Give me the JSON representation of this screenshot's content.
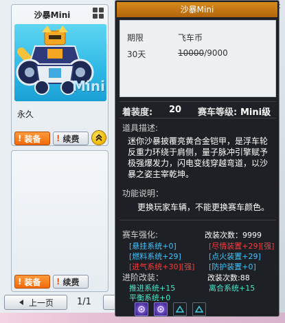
{
  "item": {
    "name": "沙暴Mini",
    "duration": "永久",
    "art_text": "Mini",
    "equip_label": "装备",
    "renew_label": "续费",
    "bang": "!"
  },
  "card2": {
    "equip_label": "装备",
    "renew_label": "续费",
    "bang": "!"
  },
  "pager": {
    "prev_label": "上一页",
    "page": "1/1"
  },
  "tooltip": {
    "title": "沙暴Mini",
    "price_header_term": "期限",
    "price_header_currency": "飞车币",
    "price_term": "30天",
    "price_original": "10000",
    "price_current": "/9000",
    "assembly_label": "着装度:",
    "assembly_value": "20",
    "grade_label": "赛车等级:",
    "grade_value": "Mini级",
    "desc_title": "道具描述:",
    "desc_text": "迷你沙暴披覆亮黄合金铠甲，是浮车轮反重力环绕于肩侧，量子脉冲引擎赋予极强爆发力，闪电变线穿越弯道，以沙暴之姿主宰乾坤。",
    "func_title": "功能说明：",
    "func_text": "更换玩家车辆，不能更换赛车颜色。",
    "tune_title": "赛车强化:",
    "tune_count_label": "改装次数：9999",
    "tune_items": [
      {
        "text": "[悬挂系统+0]",
        "color": "#3fc4ff"
      },
      {
        "text": "[尽情装置+29][强]",
        "color": "#ff3a3a"
      },
      {
        "text": "[燃料系统+29]",
        "color": "#3fc4ff"
      },
      {
        "text": "[点火装置+29]",
        "color": "#3fc4ff"
      },
      {
        "text": "[进气系统+30][强]",
        "color": "#ff3a3a"
      },
      {
        "text": "[防护装置+0]",
        "color": "#3fc4ff"
      }
    ],
    "adv_title": "进阶改装：",
    "adv_count_label": "改装次数:88",
    "adv_items": [
      {
        "text": "推进系统+15",
        "color": "#48e8c8"
      },
      {
        "text": "离合系统+15",
        "color": "#48e8c8"
      },
      {
        "text": "平衡系统+0",
        "color": "#48e8c8"
      }
    ]
  },
  "icons": {
    "close": "close-icon",
    "grid": "grid-icon",
    "chevron_up": "double-chevron-up-icon"
  },
  "colors": {
    "equip_orange": "#f26a0a",
    "title_orange": "#c2720f",
    "tooltip_bg": "#121418",
    "cyan": "#3fc4ff",
    "red": "#ff3a3a",
    "teal": "#48e8c8"
  }
}
